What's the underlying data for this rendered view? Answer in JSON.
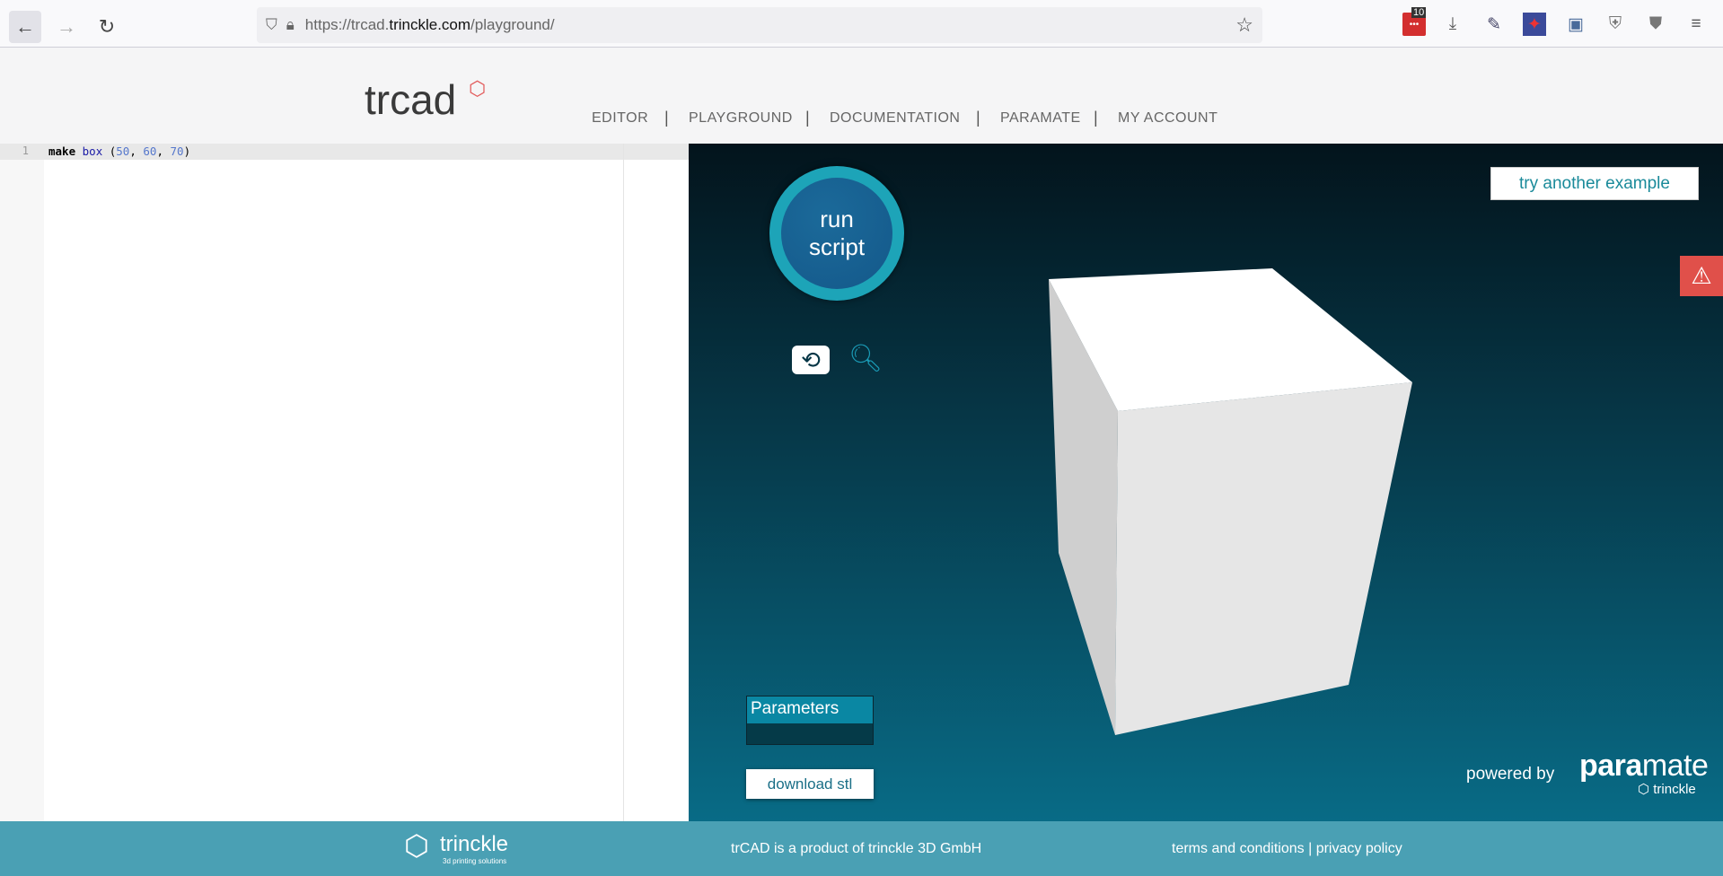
{
  "browser": {
    "url_prefix": "https://trcad.",
    "url_domain": "trinckle.com",
    "url_path": "/playground/",
    "extension_badge": "10"
  },
  "header": {
    "logo": "trcad",
    "nav": [
      "EDITOR",
      "PLAYGROUND",
      "DOCUMENTATION",
      "PARAMATE",
      "MY ACCOUNT"
    ],
    "separator": "|"
  },
  "editor": {
    "line_number": "1",
    "code": {
      "kw": "make",
      "fn": "box",
      "open": " (",
      "a": "50",
      "b": "60",
      "c": "70",
      "comma": ", ",
      "close": ")"
    }
  },
  "viewer": {
    "run_line1": "run",
    "run_line2": "script",
    "try_example": "try another example",
    "parameters": "Parameters",
    "download": "download stl",
    "powered_by": "powered by",
    "paramate_bold": "para",
    "paramate_light": "mate",
    "trinckle": "trinckle",
    "colors": {
      "box_top": "#ffffff",
      "box_front": "#e6e6e6",
      "box_left": "#cfcfcf"
    }
  },
  "footer": {
    "logo": "trinckle",
    "logo_sub": "3d printing solutions",
    "product": "trCAD is a product of trinckle 3D GmbH",
    "terms": "terms and conditions",
    "sep": "|",
    "privacy": "privacy policy"
  }
}
